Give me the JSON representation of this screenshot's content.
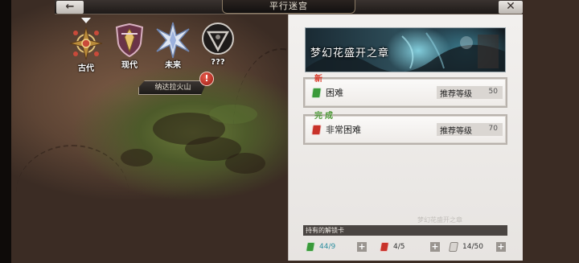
{
  "header": {
    "back_glyph": "←",
    "title": "平行迷宫",
    "close_glyph": "✕"
  },
  "eras": [
    {
      "label": "古代",
      "icon": "ornate-compass-icon",
      "selected": true
    },
    {
      "label": "现代",
      "icon": "crest-shield-icon",
      "selected": false
    },
    {
      "label": "未来",
      "icon": "crystal-star-icon",
      "selected": false
    },
    {
      "label": "???",
      "icon": "locked-triangle-icon",
      "selected": false
    }
  ],
  "map": {
    "location_label": "纳达拉火山",
    "alert_glyph": "!"
  },
  "panel": {
    "chapter_title": "梦幻花盛开之章",
    "difficulties": [
      {
        "badge": "新",
        "badge_color": "#d83a2a",
        "name": "困难",
        "icon_color": "#3a9a3a",
        "rec_label": "推荐等级",
        "rec_level": "50"
      },
      {
        "badge": "完成",
        "badge_color": "#4f9a3a",
        "name": "非常困难",
        "icon_color": "#c8322a",
        "rec_label": "推荐等级",
        "rec_level": "70"
      }
    ],
    "owned_cards_label": "持有的解锁卡",
    "ghost_caption": "梦幻花盛开之章",
    "counters": [
      {
        "icon_color": "#3a9a3a",
        "value": "44/9",
        "value_color": "#2e8fa0",
        "plus": "+"
      },
      {
        "icon_color": "#c8322a",
        "value": "4/5",
        "value_color": "#333333",
        "plus": "+"
      },
      {
        "icon_color": "#d8d4d0",
        "value": "14/50",
        "value_color": "#333333",
        "plus": "+"
      }
    ]
  }
}
